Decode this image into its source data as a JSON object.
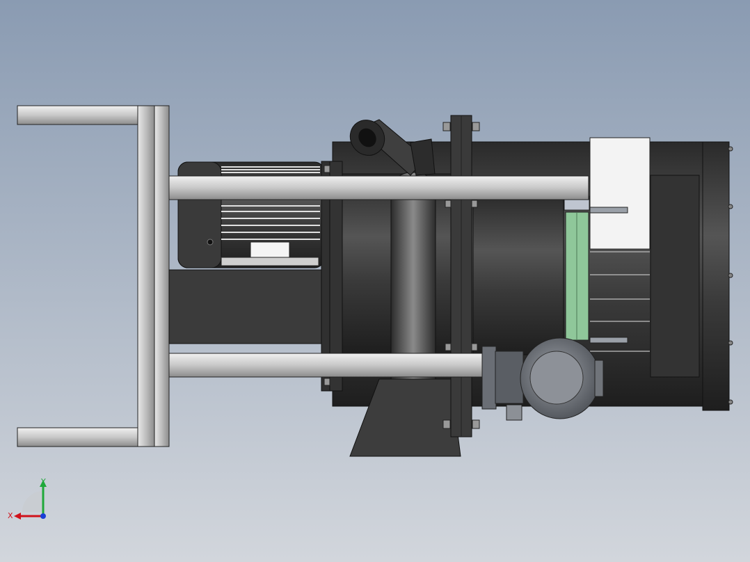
{
  "viewport": {
    "background_top": "#8a9bb2",
    "background_bottom": "#d2d6dc"
  },
  "triad": {
    "x_label": "X",
    "y_label": "Y",
    "x_color": "#d0121b",
    "y_color": "#1fa83a",
    "z_color": "#1a3fd6"
  },
  "model": {
    "frame_color": "#c9c9c9",
    "body_color": "#3e3e3e",
    "band_color": "#8fc79a",
    "panel_color": "#f2f2f2"
  }
}
